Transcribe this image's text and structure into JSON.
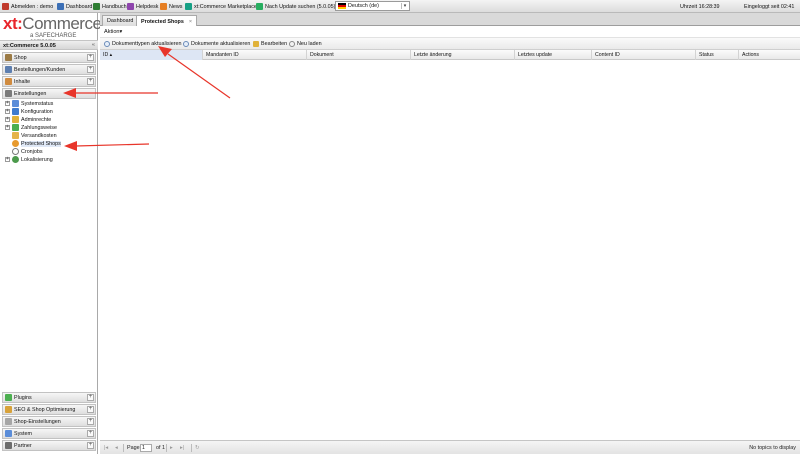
{
  "topbar": {
    "items": [
      {
        "label": "Abmelden : demo",
        "icon": "logout-icon",
        "color": "#c0392b"
      },
      {
        "label": "Dashboard",
        "icon": "dashboard-icon",
        "color": "#3b6fb6"
      },
      {
        "label": "Handbuch",
        "icon": "book-icon",
        "color": "#2e7d32"
      },
      {
        "label": "Helpdesk",
        "icon": "helpdesk-icon",
        "color": "#8e44ad"
      },
      {
        "label": "News",
        "icon": "news-icon",
        "color": "#e67e22"
      },
      {
        "label": "xt:Commerce Marketplace",
        "icon": "marketplace-icon",
        "color": "#16a085"
      },
      {
        "label": "Nach Update suchen (5.0.05)",
        "icon": "update-icon",
        "color": "#27ae60"
      }
    ],
    "language": "Deutsch (de)",
    "time": "Uhrzeit 16:28:39",
    "logged_in": "Eingeloggt seit 02:41"
  },
  "sidebar": {
    "logo_prefix": "xt",
    "logo_colon": ":",
    "logo_main": "Commerce",
    "logo_sub": "a SAFECHARGE company",
    "version": "xt:Commerce 5.0.05",
    "collapse": "«",
    "accordions_top": [
      {
        "label": "Shop",
        "icon": "shop-icon",
        "color": "#9c7b45"
      },
      {
        "label": "Bestellungen/Kunden",
        "icon": "orders-icon",
        "color": "#5d7fb0"
      },
      {
        "label": "Inhalte",
        "icon": "content-icon",
        "color": "#d08b3f"
      },
      {
        "label": "Einstellungen",
        "icon": "settings-icon",
        "color": "#7a7a7a"
      }
    ],
    "tree": [
      {
        "label": "Systemstatus",
        "icon": "status-icon",
        "color": "#5b8dd9",
        "expand": "+"
      },
      {
        "label": "Konfiguration",
        "icon": "config-icon",
        "color": "#3f7ccf",
        "expand": "+"
      },
      {
        "label": "Adminrechte",
        "icon": "key-icon",
        "color": "#e0b23a",
        "expand": "+"
      },
      {
        "label": "Zahlungsweise",
        "icon": "payment-icon",
        "color": "#4caf50",
        "expand": "+"
      },
      {
        "label": "Versandkosten",
        "icon": "shipping-icon",
        "color": "#e4b44a",
        "expand": ""
      },
      {
        "label": "Protected Shops",
        "icon": "protected-shops-icon",
        "color": "#e79a2e",
        "expand": ""
      },
      {
        "label": "Cronjobs",
        "icon": "clock-icon",
        "color": "#7a7a7a",
        "expand": ""
      },
      {
        "label": "Lokalisierung",
        "icon": "globe-icon",
        "color": "#4c9a4c",
        "expand": "+"
      }
    ],
    "accordions_bottom": [
      {
        "label": "Plugins",
        "icon": "plugin-icon",
        "color": "#4caf50"
      },
      {
        "label": "SEO & Shop Optimierung",
        "icon": "seo-icon",
        "color": "#d8a23a"
      },
      {
        "label": "Shop-Einstellungen",
        "icon": "shop-settings-icon",
        "color": "#a6a6a6"
      },
      {
        "label": "System",
        "icon": "system-icon",
        "color": "#5b8dd9"
      },
      {
        "label": "Partner",
        "icon": "partner-icon",
        "color": "#6d6d6d"
      }
    ],
    "toggle": "+"
  },
  "main": {
    "tabs": [
      {
        "label": "Dashboard"
      },
      {
        "label": "Protected Shops",
        "close": "×"
      }
    ],
    "action_menu": "Aktion",
    "action_caret": "▾",
    "toolbar": [
      {
        "label": "Dokumenttypen aktualisieren",
        "icon": "refresh-icon"
      },
      {
        "label": "Dokumente aktualisieren",
        "icon": "refresh-icon"
      },
      {
        "label": "Bearbeiten",
        "icon": "edit-icon"
      },
      {
        "label": "Neu laden",
        "icon": "reload-icon"
      }
    ],
    "columns": [
      "ID",
      "Mandanten ID",
      "Dokument",
      "Letzte änderung",
      "Letztes update",
      "Content ID",
      "Status",
      "Actions"
    ],
    "sort_indicator": "▴",
    "pager": {
      "page_label": "Page",
      "page_value": "1",
      "of_label": "of 1",
      "first": "|◂",
      "prev": "◂",
      "next": "▸",
      "last": "▸|",
      "refresh": "↻",
      "status": "No topics to display"
    }
  },
  "colors": {
    "arrow": "#e8352a",
    "accent_red": "#e8252b",
    "selection": "#dfe8f6"
  }
}
